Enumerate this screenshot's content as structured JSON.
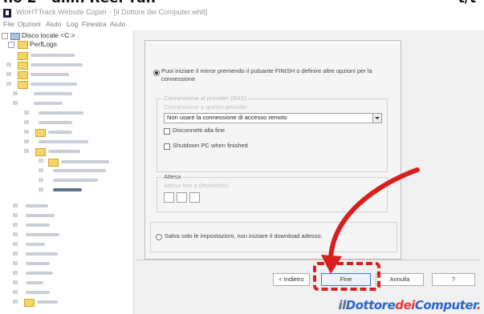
{
  "page_heading": {
    "left": "no 2 - allin Reer ran",
    "right": "t/t"
  },
  "window": {
    "title": "WinHTTrack Website Copier - [Il Dottore dei Computer.whtt]",
    "menu": [
      "File",
      "Opzioni",
      "Aiuto",
      "Log",
      "Finestra",
      "Aiuto"
    ]
  },
  "tree": {
    "root_label": "Disco locale <C:>",
    "child_label": "PerfLogs"
  },
  "wizard": {
    "radio_1_text": "Puoi iniziare il mirror premendo il pulsante FINISH o definire altre opzioni per la connessione",
    "connection_group_title": "Connessione al provider (RAS)",
    "connection_group_sub": "Connessione a questo provider",
    "connection_select_value": "Non usare la connessione di accesso remoto",
    "checkbox_disconnect": "Disconnetti alla fine",
    "checkbox_shutdown": "Shutdown PC when finished",
    "wait_group_title": "Attesa",
    "wait_group_sub": "Attesa fino a (hh/mm/ss)",
    "radio_2_text": "Salva solo le impostazioni, non iniziare il download adesso."
  },
  "buttons": {
    "back": "< Indietro",
    "finish": "Fine",
    "cancel": "Annulla",
    "help": "?"
  },
  "watermark": {
    "part1": "il",
    "part2": "Dottore",
    "part3": "dei",
    "part4": "Computer",
    "part5": "."
  }
}
